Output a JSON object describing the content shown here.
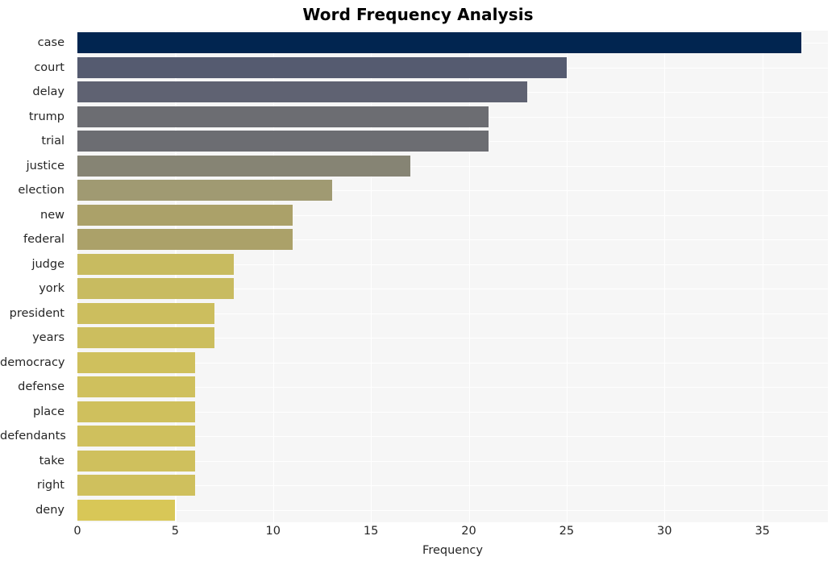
{
  "chart_data": {
    "type": "bar",
    "orientation": "horizontal",
    "title": "Word Frequency Analysis",
    "xlabel": "Frequency",
    "ylabel": "",
    "categories": [
      "case",
      "court",
      "delay",
      "trump",
      "trial",
      "justice",
      "election",
      "new",
      "federal",
      "judge",
      "york",
      "president",
      "years",
      "democracy",
      "defense",
      "place",
      "defendants",
      "take",
      "right",
      "deny"
    ],
    "values": [
      37,
      25,
      23,
      21,
      21,
      17,
      13,
      11,
      11,
      8,
      8,
      7,
      7,
      6,
      6,
      6,
      6,
      6,
      6,
      5
    ],
    "bar_colors": [
      "#012550",
      "#555b70",
      "#5f6272",
      "#6c6d72",
      "#6c6d72",
      "#868474",
      "#a09a72",
      "#aba169",
      "#aba169",
      "#c8bb60",
      "#c8bb60",
      "#ccbe5e",
      "#ccbe5e",
      "#cfc05d",
      "#cfc05d",
      "#cfc05d",
      "#cfc05d",
      "#cfc05d",
      "#cfc05d",
      "#d8c757"
    ],
    "xlim": [
      0,
      38.35
    ],
    "xticks": [
      0,
      5,
      10,
      15,
      20,
      25,
      30,
      35
    ],
    "xtick_labels": [
      "0",
      "5",
      "10",
      "15",
      "20",
      "25",
      "30",
      "35"
    ],
    "grid": true,
    "grid_color": "#ffffff",
    "plot_background": "#f6f6f6",
    "figure_background": "#ffffff",
    "legend": null
  }
}
